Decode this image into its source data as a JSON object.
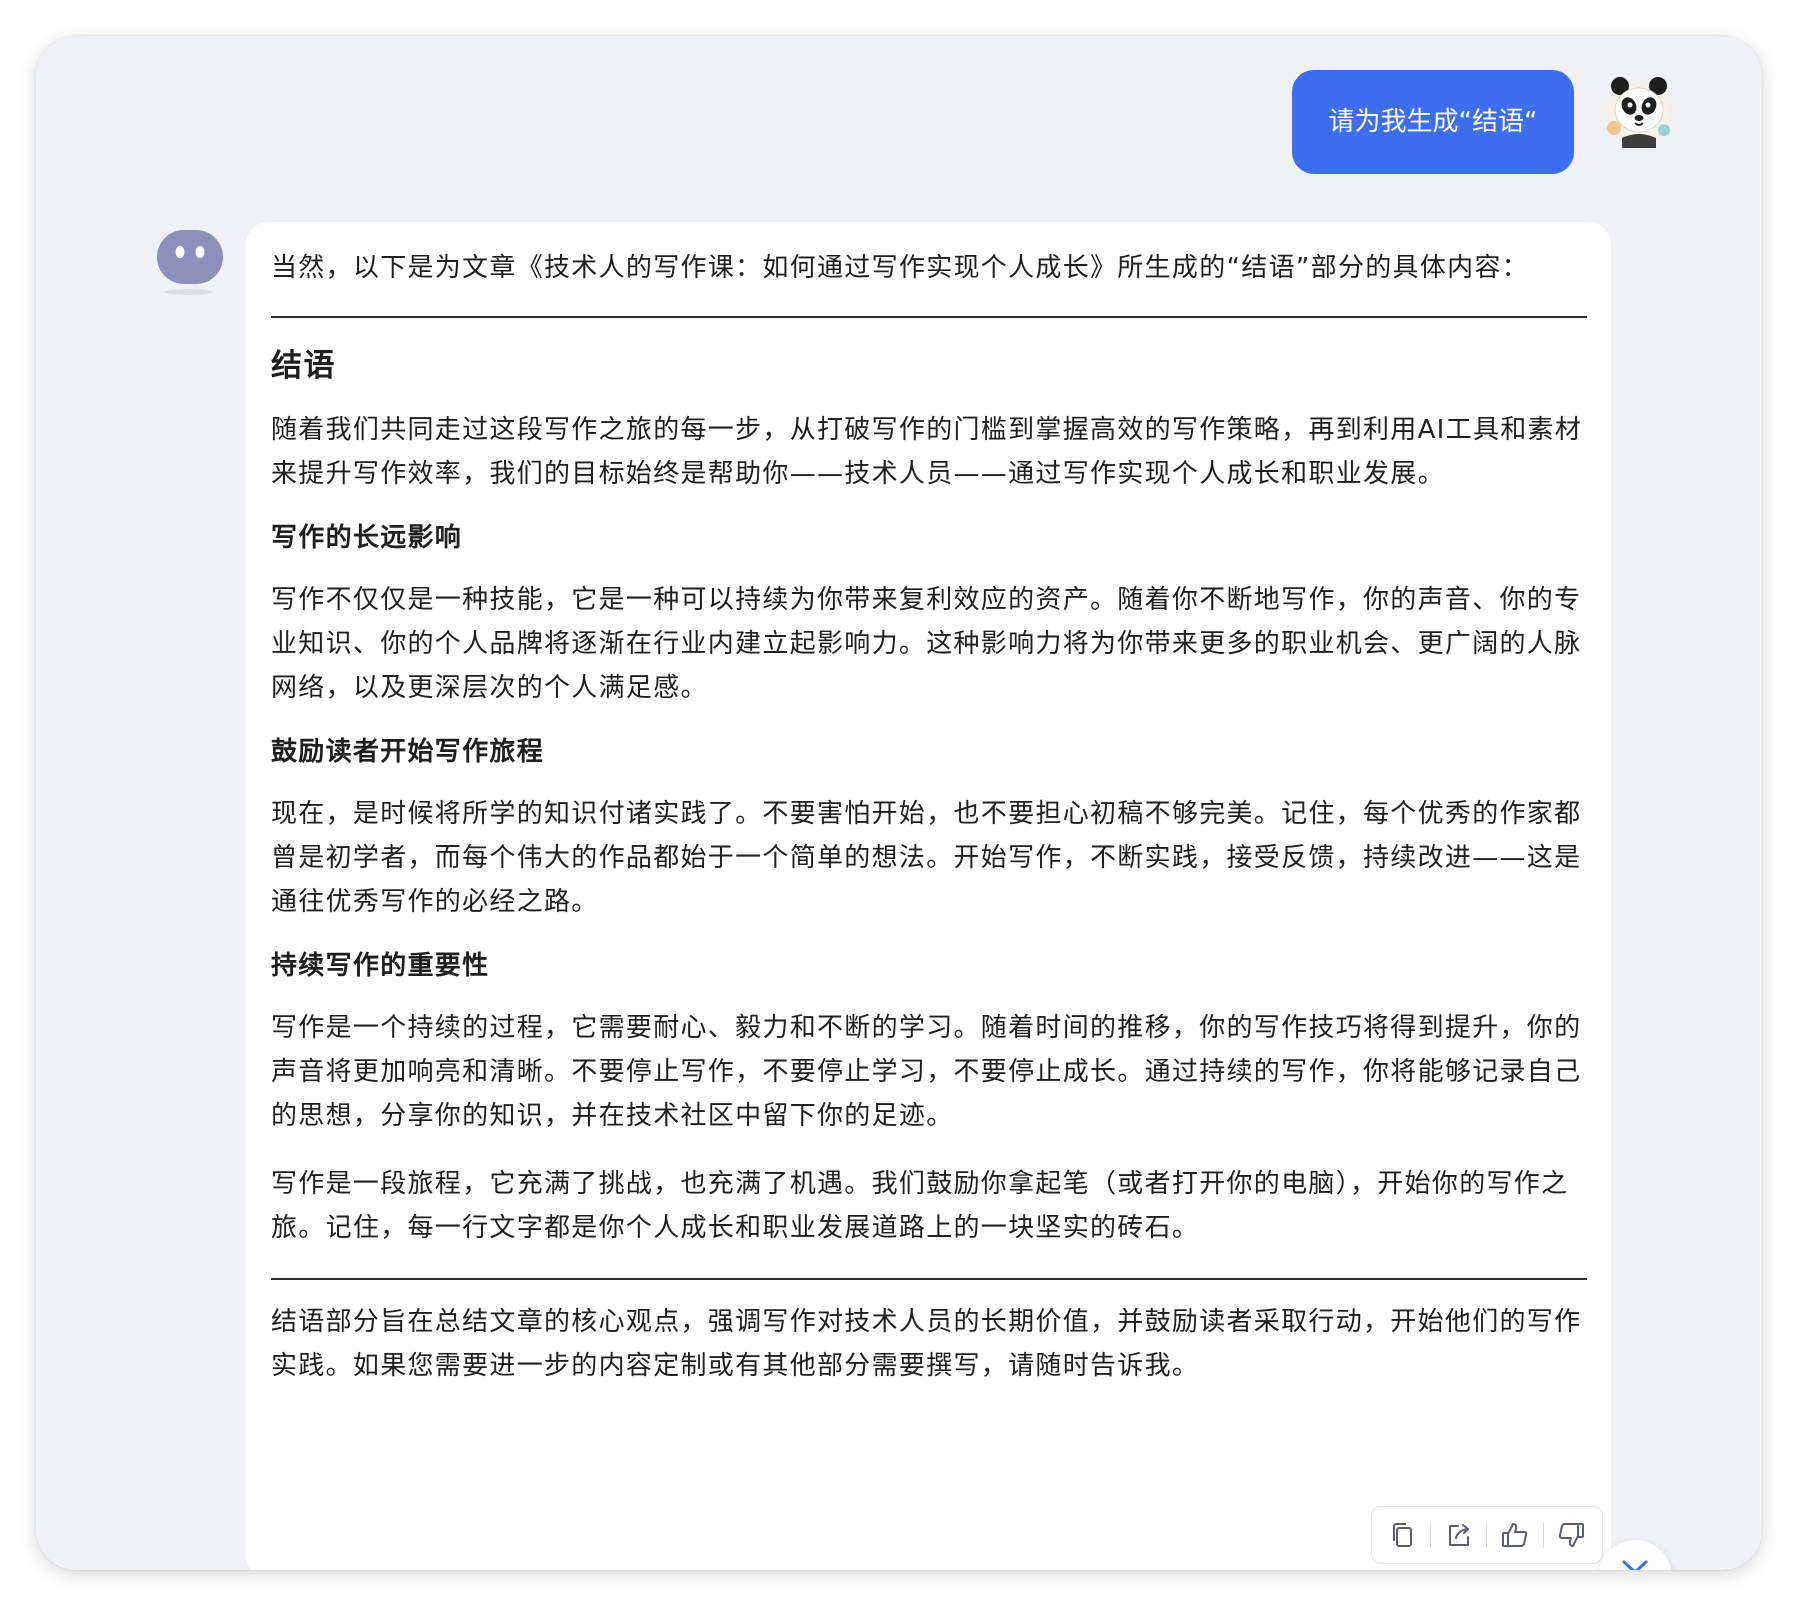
{
  "user_message": {
    "text": "请为我生成“结语“",
    "avatar_icon": "panda-avatar-icon",
    "bubble_color": "#3e6ef0"
  },
  "assistant": {
    "avatar_icon": "robot-avatar-icon",
    "intro": "当然，以下是为文章《技术人的写作课：如何通过写作实现个人成长》所生成的“结语”部分的具体内容：",
    "heading": "结语",
    "lead_paragraph": "随着我们共同走过这段写作之旅的每一步，从打破写作的门槛到掌握高效的写作策略，再到利用AI工具和素材来提升写作效率，我们的目标始终是帮助你——技术人员——通过写作实现个人成长和职业发展。",
    "sections": [
      {
        "title": "写作的长远影响",
        "body": "写作不仅仅是一种技能，它是一种可以持续为你带来复利效应的资产。随着你不断地写作，你的声音、你的专业知识、你的个人品牌将逐渐在行业内建立起影响力。这种影响力将为你带来更多的职业机会、更广阔的人脉网络，以及更深层次的个人满足感。"
      },
      {
        "title": "鼓励读者开始写作旅程",
        "body": "现在，是时候将所学的知识付诸实践了。不要害怕开始，也不要担心初稿不够完美。记住，每个优秀的作家都曾是初学者，而每个伟大的作品都始于一个简单的想法。开始写作，不断实践，接受反馈，持续改进——这是通往优秀写作的必经之路。"
      },
      {
        "title": "持续写作的重要性",
        "body": "写作是一个持续的过程，它需要耐心、毅力和不断的学习。随着时间的推移，你的写作技巧将得到提升，你的声音将更加响亮和清晰。不要停止写作，不要停止学习，不要停止成长。通过持续的写作，你将能够记录自己的思想，分享你的知识，并在技术社区中留下你的足迹。"
      }
    ],
    "closing_paragraph": "写作是一段旅程，它充满了挑战，也充满了机遇。我们鼓励你拿起笔（或者打开你的电脑），开始你的写作之旅。记住，每一行文字都是你个人成长和职业发展道路上的一块坚实的砖石。",
    "final_note": "结语部分旨在总结文章的核心观点，强调写作对技术人员的长期价值，并鼓励读者采取行动，开始他们的写作实践。如果您需要进一步的内容定制或有其他部分需要撰写，请随时告诉我。"
  },
  "actions": [
    {
      "icon": "copy-icon"
    },
    {
      "icon": "share-icon"
    },
    {
      "icon": "thumbs-up-icon"
    },
    {
      "icon": "thumbs-down-icon"
    }
  ],
  "scroll_button": {
    "icon": "chevron-down-icon"
  },
  "colors": {
    "background": "#f0f1f5",
    "card": "#ffffff",
    "text": "#1f1f1f",
    "bot_avatar": "#8b91b8"
  }
}
